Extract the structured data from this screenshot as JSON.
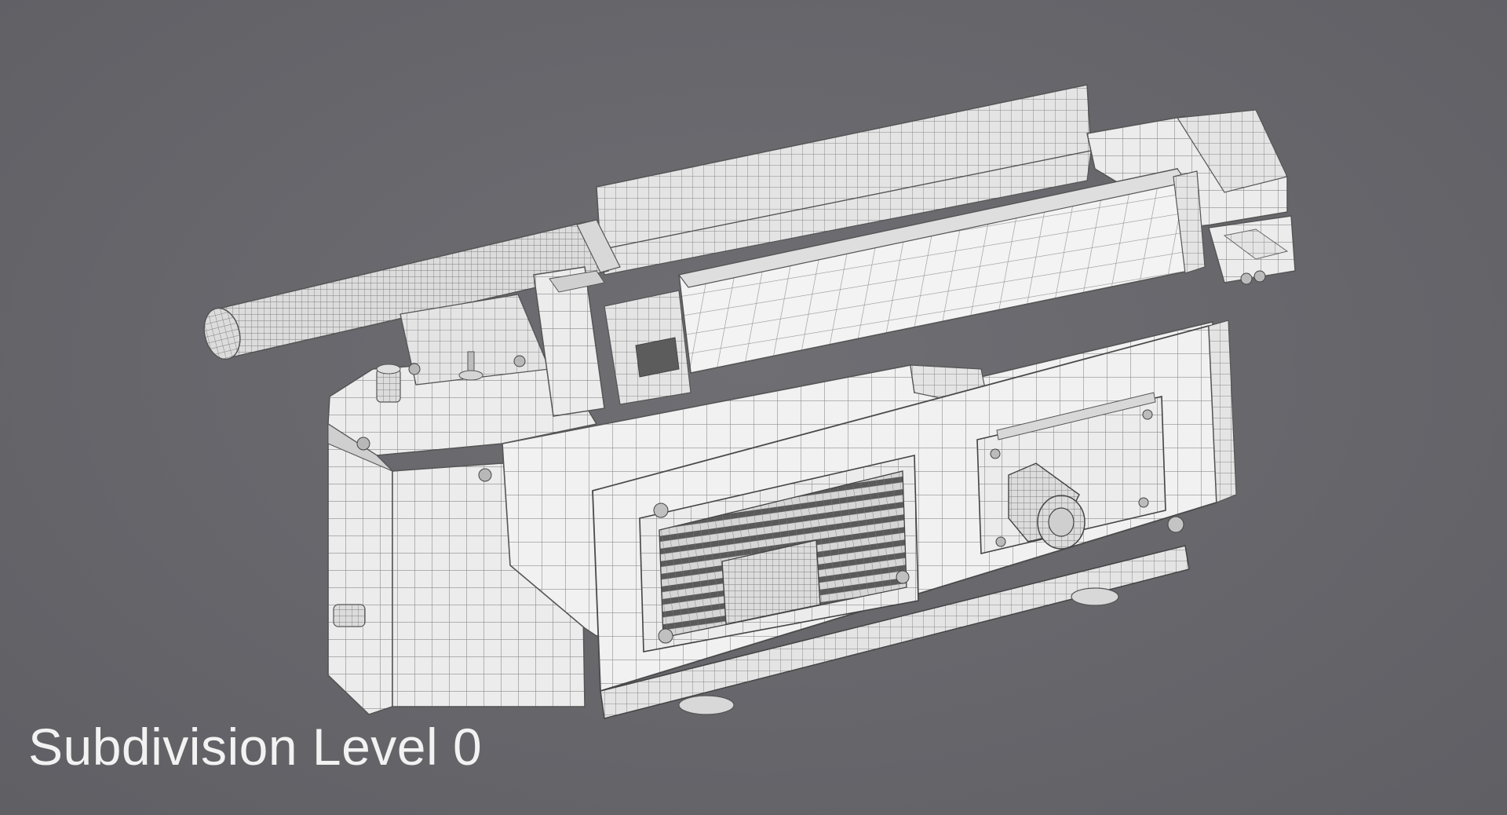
{
  "caption": {
    "text": "Subdivision Level 0"
  },
  "scene": {
    "subject": "wireframe-3d-model",
    "background_color": "#68686d",
    "model_color": "#ececec",
    "wire_color": "#8a8a8a"
  }
}
